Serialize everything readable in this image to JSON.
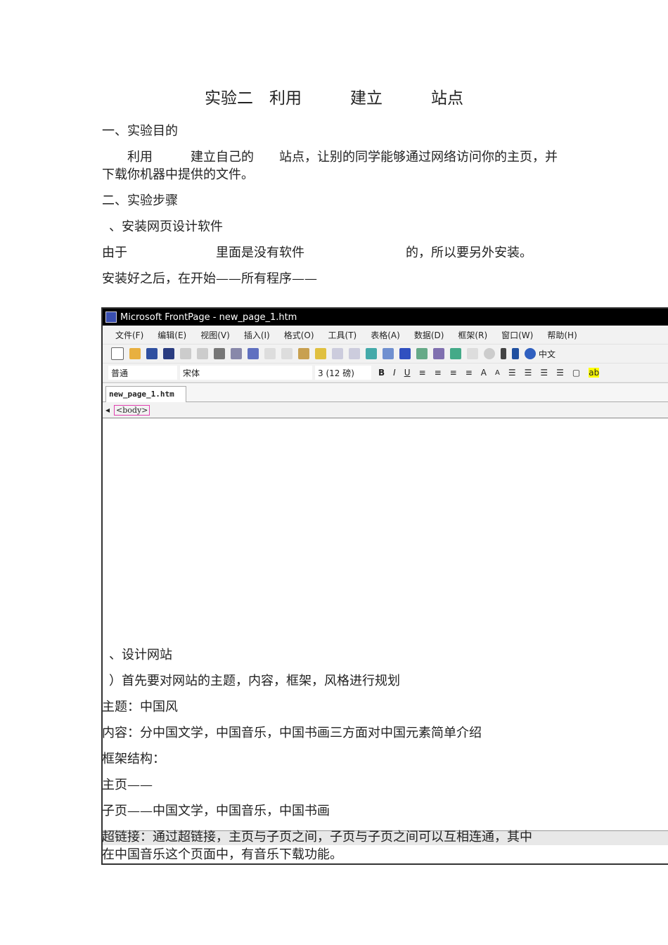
{
  "title": "实验二　利用　　　建立　　　站点",
  "lines": [
    "一、实验目的",
    "　　利用　　　建立自己的　　站点，让别的同学能够通过网络访问你的主页，并",
    "下载你机器中提供的文件。",
    "二、实验步骤",
    "、安装网页设计软件",
    "由于　　　　　　　里面是没有软件　　　　　　　　的，所以要另外安装。",
    "安装好之后，在开始——所有程序——"
  ],
  "screenshot": {
    "window_title": "Microsoft FrontPage - new_page_1.htm",
    "menu": [
      "文件(F)",
      "编辑(E)",
      "视图(V)",
      "插入(I)",
      "格式(O)",
      "工具(T)",
      "表格(A)",
      "数据(D)",
      "框架(R)",
      "窗口(W)",
      "帮助(H)"
    ],
    "toolbar_ime": "中文",
    "style": "普通",
    "font": "宋体",
    "size": "3 (12 磅)",
    "tab": "new_page_1.htm",
    "tag": "<body>"
  },
  "lines2": [
    "、设计网站",
    "）首先要对网站的主题，内容，框架，风格进行规划",
    "主题：中国风",
    "内容：分中国文学，中国音乐，中国书画三方面对中国元素简单介绍",
    "框架结构：",
    "主页——",
    "子页——中国文学，中国音乐，中国书画",
    "超链接：通过超链接，主页与子页之间，子页与子页之间可以互相连通，其中",
    "在中国音乐这个页面中，有音乐下载功能。"
  ]
}
